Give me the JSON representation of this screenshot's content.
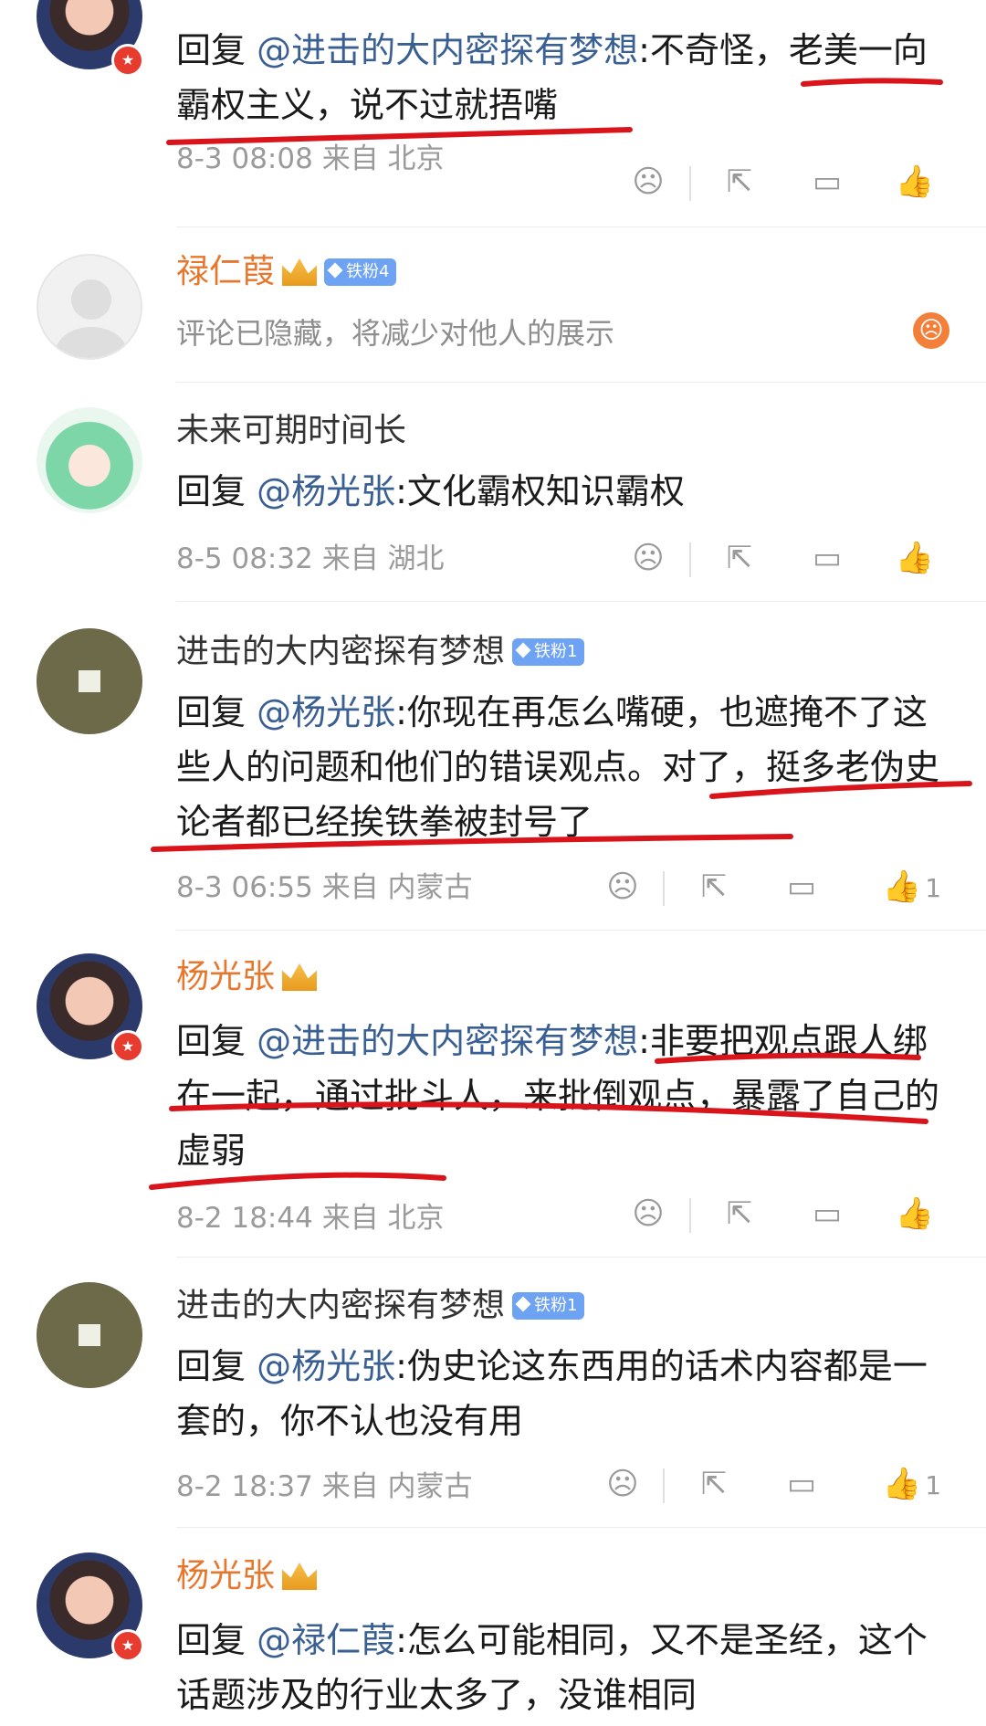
{
  "comments": [
    {
      "text_prefix": "回复 ",
      "mention": "@进击的大内密探有梦想",
      "text_body": ":不奇怪，老美一向霸权主义，说不过就捂嘴",
      "time": "8-3 08:08",
      "source": "来自 北京"
    },
    {
      "username": "禄仁葭",
      "fan_badge": "铁粉4",
      "hidden_text": "评论已隐藏，将减少对他人的展示"
    },
    {
      "username": "未来可期时间长",
      "text_prefix": "回复 ",
      "mention": "@杨光张",
      "text_body": ":文化霸权知识霸权",
      "time": "8-5 08:32",
      "source": "来自 湖北"
    },
    {
      "username": "进击的大内密探有梦想",
      "fan_badge": "铁粉1",
      "text_prefix": "回复 ",
      "mention": "@杨光张",
      "text_body": ":你现在再怎么嘴硬，也遮掩不了这些人的问题和他们的错误观点。对了，挺多老伪史论者都已经挨铁拳被封号了",
      "time": "8-3 06:55",
      "source": "来自 内蒙古",
      "like_count": "1"
    },
    {
      "username": "杨光张",
      "text_prefix": "回复 ",
      "mention": "@进击的大内密探有梦想",
      "text_body": ":非要把观点跟人绑在一起，通过批斗人，来批倒观点，暴露了自己的虚弱",
      "time": "8-2 18:44",
      "source": "来自 北京"
    },
    {
      "username": "进击的大内密探有梦想",
      "fan_badge": "铁粉1",
      "text_prefix": "回复 ",
      "mention": "@杨光张",
      "text_body": ":伪史论这东西用的话术内容都是一套的，你不认也没有用",
      "time": "8-2 18:37",
      "source": "来自 内蒙古",
      "like_count": "1"
    },
    {
      "username": "杨光张",
      "text_prefix": "回复 ",
      "mention": "@禄仁葭",
      "text_body": ":怎么可能相同，又不是圣经，这个话题涉及的行业太多了，没谁相同"
    }
  ],
  "icons": {
    "dislike": "sad-face-icon",
    "share": "share-icon",
    "comment": "comment-icon",
    "like": "thumbs-up-icon"
  },
  "colors": {
    "username_orange": "#e8772e",
    "mention_blue": "#3a5f93",
    "fan_badge_blue": "#6ea3f3",
    "annotation_red": "#d9141b",
    "meta_gray": "#9a9a9a"
  }
}
